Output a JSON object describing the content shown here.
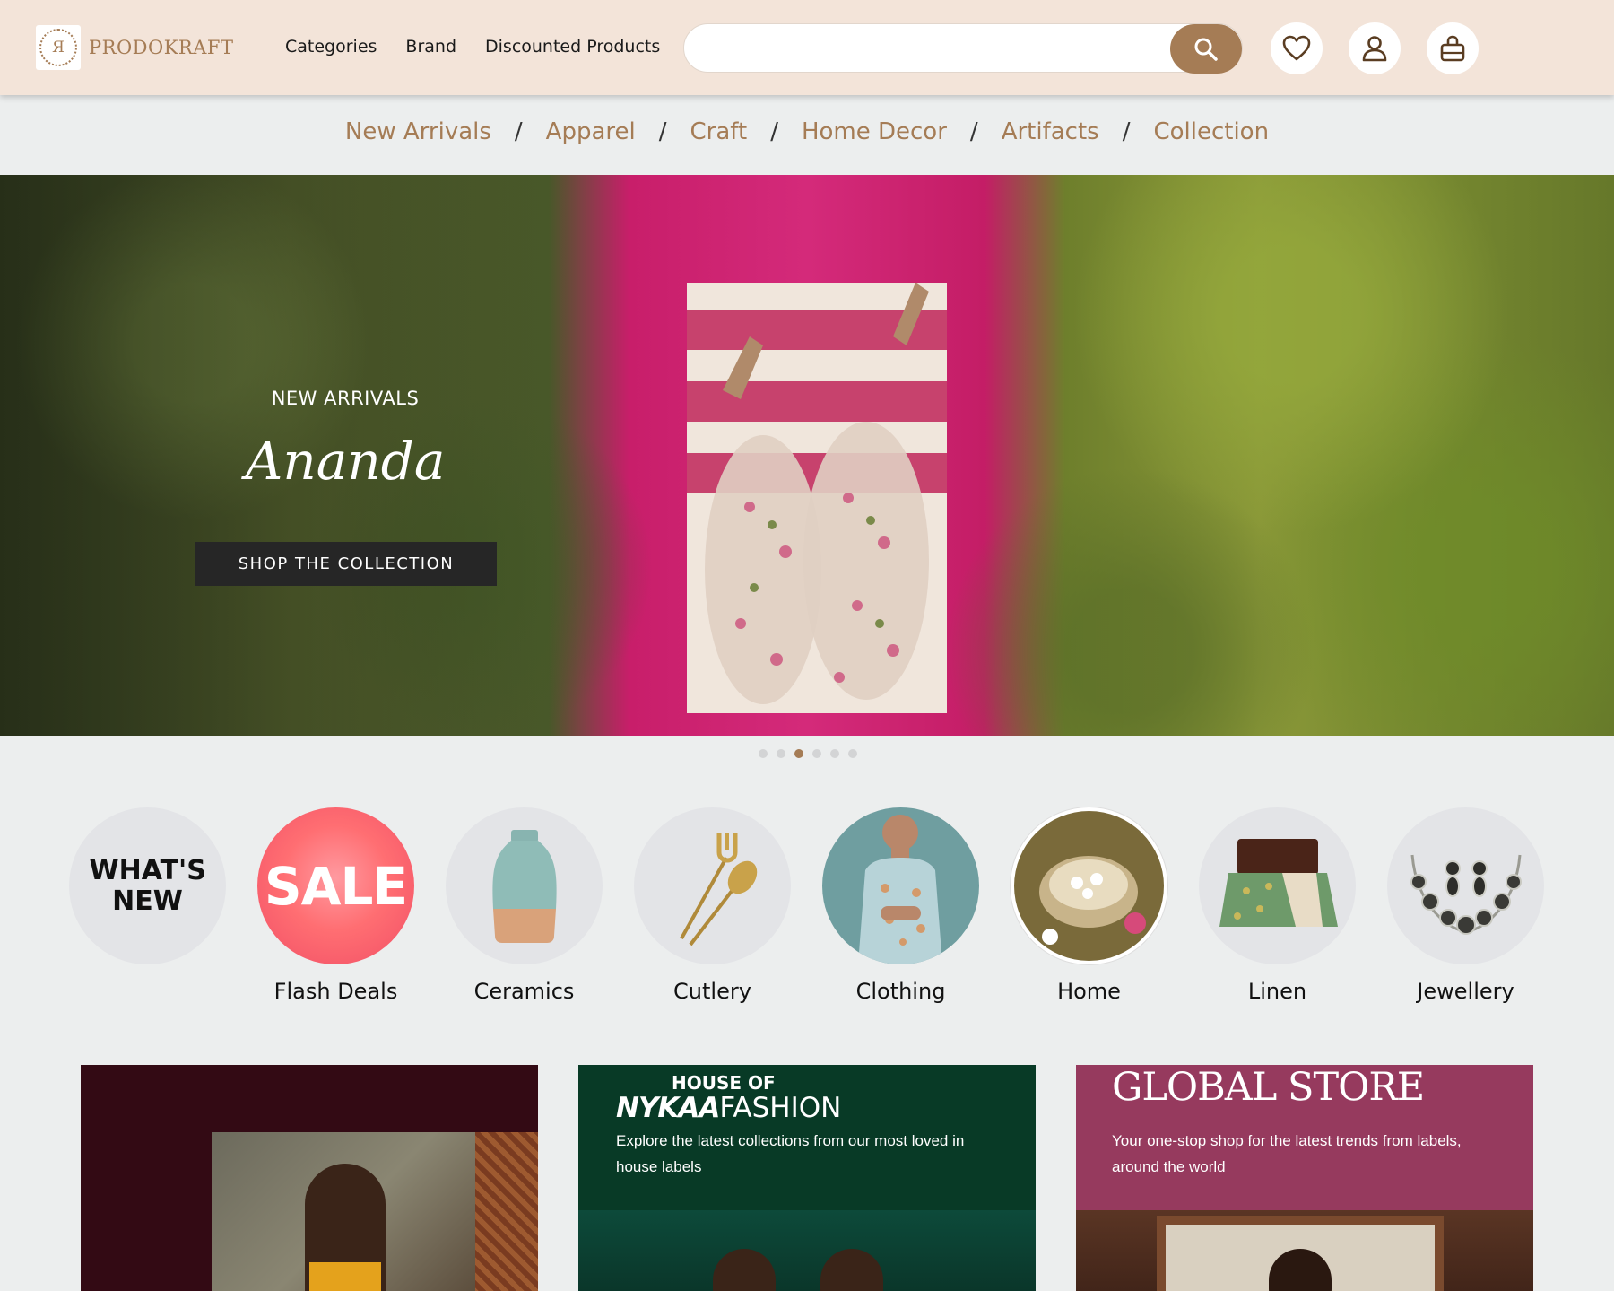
{
  "brand": {
    "name": "PRODOKRAFT",
    "monogram": "Я",
    "color": "#a57c55"
  },
  "topnav": [
    "Categories",
    "Brand",
    "Discounted Products"
  ],
  "search": {
    "placeholder": "",
    "button_icon": "search-icon"
  },
  "header_icons": [
    "heart-icon",
    "user-icon",
    "shopping-bag-icon"
  ],
  "category_nav": [
    "New Arrivals",
    "Apparel",
    "Craft",
    "Home Decor",
    "Artifacts",
    "Collection"
  ],
  "hero": {
    "kicker": "NEW ARRIVALS",
    "title": "Ananda",
    "cta": "SHOP THE COLLECTION",
    "slides": 6,
    "active_slide": 3
  },
  "categories": [
    {
      "label": "",
      "badge": "WHAT'S NEW"
    },
    {
      "label": "Flash Deals",
      "badge": "SALE"
    },
    {
      "label": "Ceramics"
    },
    {
      "label": "Cutlery"
    },
    {
      "label": "Clothing"
    },
    {
      "label": "Home"
    },
    {
      "label": "Linen"
    },
    {
      "label": "Jewellery"
    }
  ],
  "promos": {
    "nykaa": {
      "top": "HOUSE OF",
      "brand": "NYKAA",
      "word": "FASHION",
      "desc": "Explore the latest collections from our most loved in house labels"
    },
    "global": {
      "title": "GLOBAL STORE",
      "desc": "Your one-stop shop for the latest trends from labels, around the world"
    }
  },
  "colors": {
    "accent": "#a57c55",
    "header_bg": "#f3e4d9",
    "page_bg": "#eceeee",
    "nykaa_bg": "#083a26",
    "global_bg": "#963a5e",
    "card_dark": "#330a14"
  }
}
